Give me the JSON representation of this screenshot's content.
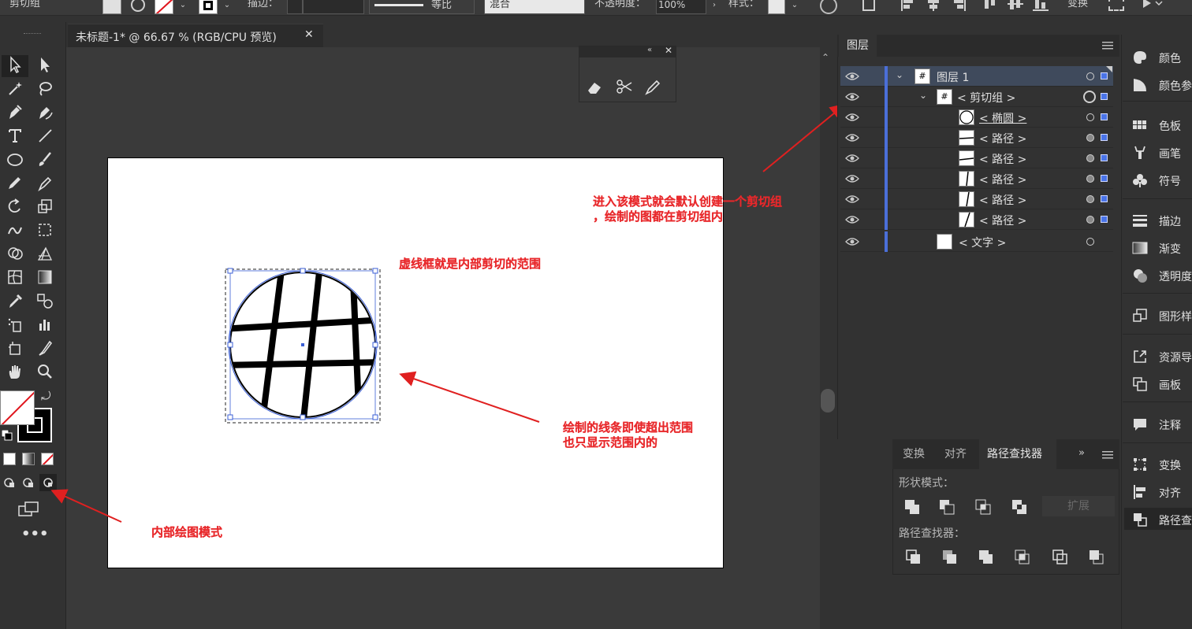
{
  "app": {
    "panel_title": "剪切组"
  },
  "control_bar": {
    "stroke_label": "描边：",
    "profile_label": "等比",
    "blend_mode": "混合",
    "opacity_label": "不透明度：",
    "opacity_value": "100%",
    "style_label": "样式：",
    "transform_label": "变换"
  },
  "document": {
    "tab_title": "未标题-1* @ 66.67 % (RGB/CPU 预览)",
    "close_glyph": "✕"
  },
  "annotations": {
    "clip_range": "虚线框就是内部剪切的范围",
    "lines_inside": [
      "绘制的线条即使超出范围",
      "也只显示范围内的"
    ],
    "mode_created": [
      "进入该模式就会默认创建一个剪切组",
      "，绘制的图都在剪切组内"
    ],
    "draw_inside": "内部绘图模式"
  },
  "layers_panel": {
    "tab": "图层",
    "rows": [
      {
        "name": "图层  1"
      },
      {
        "name": "< 剪切组 >"
      },
      {
        "name": "< 椭圆 >"
      },
      {
        "name": "< 路径 >"
      },
      {
        "name": "< 路径 >"
      },
      {
        "name": "< 路径 >"
      },
      {
        "name": "< 路径 >"
      },
      {
        "name": "< 路径 >"
      },
      {
        "name": "< 文字 >"
      }
    ]
  },
  "pathfinder_panel": {
    "tabs": [
      "变换",
      "对齐",
      "路径查找器"
    ],
    "shape_modes_label": "形状模式：",
    "expand_label": "扩展",
    "pathfinders_label": "路径查找器："
  },
  "dock": {
    "items": [
      "颜色",
      "颜色参",
      "色板",
      "画笔",
      "符号",
      "描边",
      "渐变",
      "透明度",
      "图形样",
      "资源导",
      "画板",
      "注释",
      "变换",
      "对齐",
      "路径查"
    ]
  }
}
